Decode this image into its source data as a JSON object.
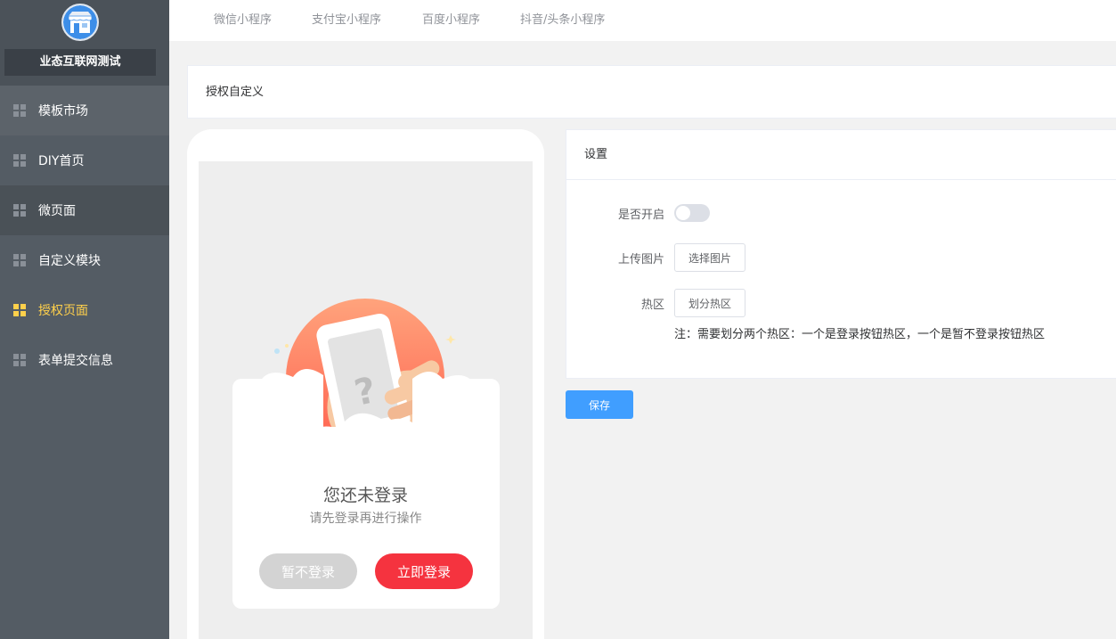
{
  "app": {
    "shop_name": "业态互联网测试"
  },
  "sidebar": {
    "items": [
      {
        "label": "模板市场"
      },
      {
        "label": "DIY首页"
      },
      {
        "label": "微页面"
      },
      {
        "label": "自定义模块"
      },
      {
        "label": "授权页面",
        "active": true
      },
      {
        "label": "表单提交信息"
      }
    ]
  },
  "tabs": [
    {
      "label": "微信小程序"
    },
    {
      "label": "支付宝小程序"
    },
    {
      "label": "百度小程序"
    },
    {
      "label": "抖音/头条小程序"
    }
  ],
  "page": {
    "title": "授权自定义"
  },
  "preview": {
    "login_title": "您还未登录",
    "login_subtitle": "请先登录再进行操作",
    "later_button": "暂不登录",
    "login_button": "立即登录"
  },
  "settings": {
    "header": "设置",
    "enable_label": "是否开启",
    "enable_value": false,
    "upload_label": "上传图片",
    "upload_button": "选择图片",
    "hotzone_label": "热区",
    "hotzone_button": "划分热区",
    "note": "注：需要划分两个热区：一个是登录按钮热区，一个是暂不登录按钮热区"
  },
  "save_button": "保存",
  "colors": {
    "sidebar_bg": "#545c64",
    "active": "#ffd04b",
    "primary": "#409eff",
    "login_red": "#f5333f"
  }
}
